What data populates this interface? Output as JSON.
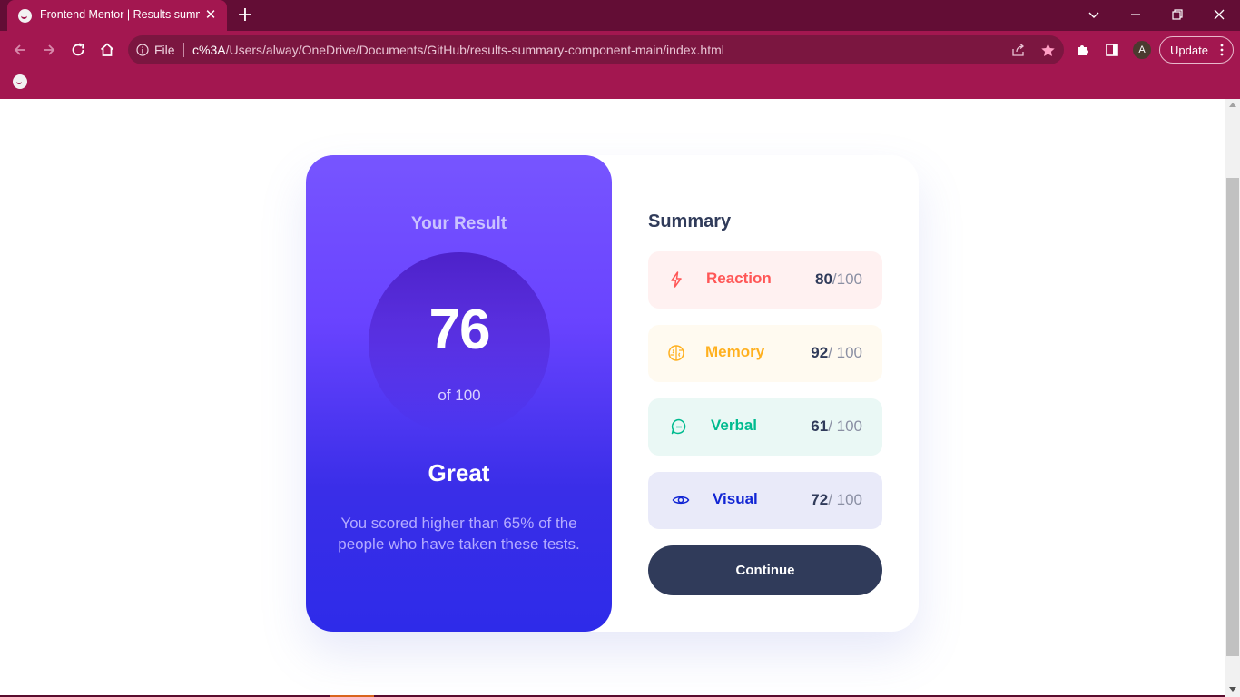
{
  "browser": {
    "tab": {
      "title": "Frontend Mentor | Results summary component"
    },
    "site_info_label": "File",
    "url_host": "c%3A",
    "url_path": "/Users/alway/OneDrive/Documents/GitHub/results-summary-component-main/index.html",
    "profile_initial": "A",
    "update_label": "Update",
    "colors": {
      "frame": "#630d35",
      "toolbar": "#a31750",
      "omnibox": "#7b1640"
    }
  },
  "result": {
    "heading": "Your Result",
    "score": "76",
    "out_of": "of 100",
    "grade": "Great",
    "description": "You scored higher than 65% of the people who have taken these tests."
  },
  "summary": {
    "title": "Summary",
    "items": [
      {
        "icon": "lightning-icon",
        "label": "Reaction",
        "score": "80",
        "total": "/100",
        "color": "#ff5757",
        "bg": "#fff1f1"
      },
      {
        "icon": "brain-icon",
        "label": "Memory",
        "score": "92",
        "total": "/ 100",
        "color": "#ffb01f",
        "bg": "#fffaf0"
      },
      {
        "icon": "chat-bubble-icon",
        "label": "Verbal",
        "score": "61",
        "total": "/ 100",
        "color": "#00bb8f",
        "bg": "#eaf8f5"
      },
      {
        "icon": "eye-icon",
        "label": "Visual",
        "score": "72",
        "total": "/ 100",
        "color": "#1125d4",
        "bg": "#e9eaf9"
      }
    ],
    "continue_label": "Continue"
  }
}
